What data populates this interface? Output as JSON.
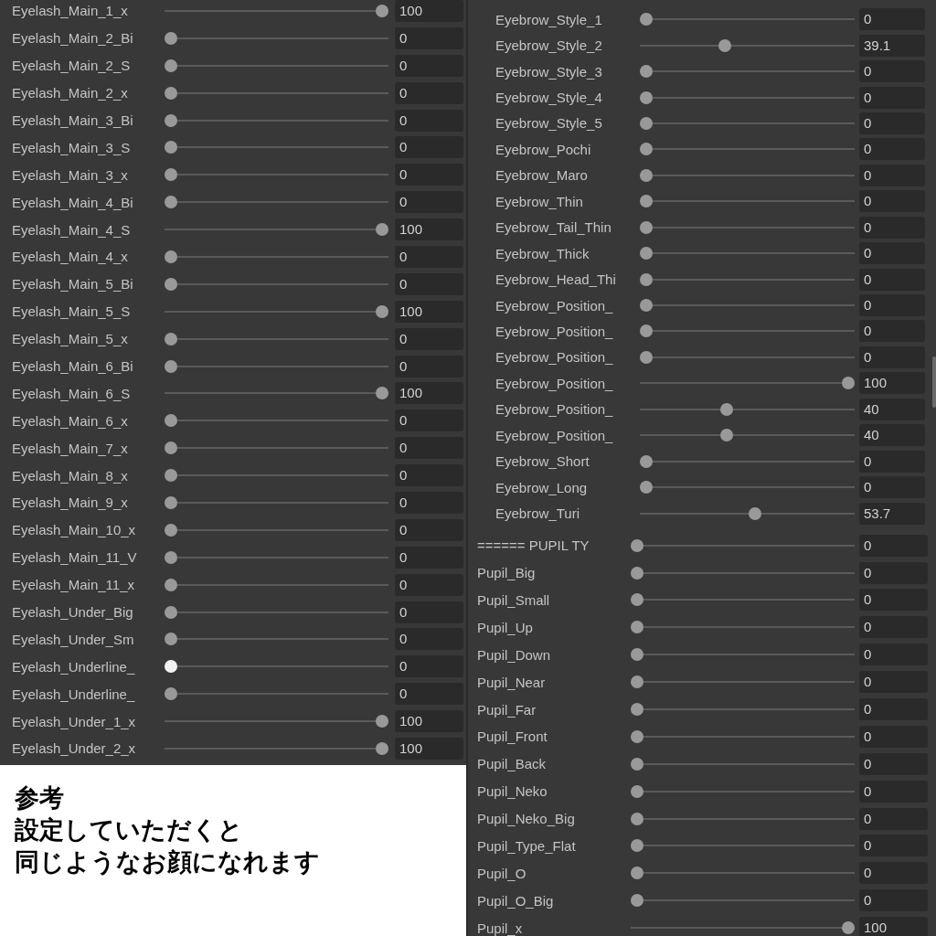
{
  "left_panel": {
    "sliders": [
      {
        "label": "Eyelash_Main_1_x",
        "level": 1,
        "value": "100",
        "active": false
      },
      {
        "label": "Eyelash_Main_2_Bi",
        "level": 0,
        "value": "0",
        "active": false
      },
      {
        "label": "Eyelash_Main_2_S",
        "level": 0,
        "value": "0",
        "active": false
      },
      {
        "label": "Eyelash_Main_2_x",
        "level": 0,
        "value": "0",
        "active": false
      },
      {
        "label": "Eyelash_Main_3_Bi",
        "level": 0,
        "value": "0",
        "active": false
      },
      {
        "label": "Eyelash_Main_3_S",
        "level": 0,
        "value": "0",
        "active": false
      },
      {
        "label": "Eyelash_Main_3_x",
        "level": 0,
        "value": "0",
        "active": false
      },
      {
        "label": "Eyelash_Main_4_Bi",
        "level": 0,
        "value": "0",
        "active": false
      },
      {
        "label": "Eyelash_Main_4_S",
        "level": 1,
        "value": "100",
        "active": false
      },
      {
        "label": "Eyelash_Main_4_x",
        "level": 0,
        "value": "0",
        "active": false
      },
      {
        "label": "Eyelash_Main_5_Bi",
        "level": 0,
        "value": "0",
        "active": false
      },
      {
        "label": "Eyelash_Main_5_S",
        "level": 1,
        "value": "100",
        "active": false
      },
      {
        "label": "Eyelash_Main_5_x",
        "level": 0,
        "value": "0",
        "active": false
      },
      {
        "label": "Eyelash_Main_6_Bi",
        "level": 0,
        "value": "0",
        "active": false
      },
      {
        "label": "Eyelash_Main_6_S",
        "level": 1,
        "value": "100",
        "active": false
      },
      {
        "label": "Eyelash_Main_6_x",
        "level": 0,
        "value": "0",
        "active": false
      },
      {
        "label": "Eyelash_Main_7_x",
        "level": 0,
        "value": "0",
        "active": false
      },
      {
        "label": "Eyelash_Main_8_x",
        "level": 0,
        "value": "0",
        "active": false
      },
      {
        "label": "Eyelash_Main_9_x",
        "level": 0,
        "value": "0",
        "active": false
      },
      {
        "label": "Eyelash_Main_10_x",
        "level": 0,
        "value": "0",
        "active": false
      },
      {
        "label": "Eyelash_Main_11_V",
        "level": 0,
        "value": "0",
        "active": false
      },
      {
        "label": "Eyelash_Main_11_x",
        "level": 0,
        "value": "0",
        "active": false
      },
      {
        "label": "Eyelash_Under_Big",
        "level": 0,
        "value": "0",
        "active": false
      },
      {
        "label": "Eyelash_Under_Sm",
        "level": 0,
        "value": "0",
        "active": false
      },
      {
        "label": "Eyelash_Underline_",
        "level": 0,
        "value": "0",
        "active": true
      },
      {
        "label": "Eyelash_Underline_",
        "level": 0,
        "value": "0",
        "active": false
      },
      {
        "label": "Eyelash_Under_1_x",
        "level": 1,
        "value": "100",
        "active": false
      },
      {
        "label": "Eyelash_Under_2_x",
        "level": 1,
        "value": "100",
        "active": false
      }
    ]
  },
  "caption": {
    "lines": [
      "参考",
      "設定していただくと",
      "同じようなお顔になれます"
    ]
  },
  "right_panel": {
    "eyebrow_sliders": [
      {
        "label": "Eyebrow_Style_1",
        "level": 0,
        "value": "0"
      },
      {
        "label": "Eyebrow_Style_2",
        "level": 0.391,
        "value": "39.1"
      },
      {
        "label": "Eyebrow_Style_3",
        "level": 0,
        "value": "0"
      },
      {
        "label": "Eyebrow_Style_4",
        "level": 0,
        "value": "0"
      },
      {
        "label": "Eyebrow_Style_5",
        "level": 0,
        "value": "0"
      },
      {
        "label": "Eyebrow_Pochi",
        "level": 0,
        "value": "0"
      },
      {
        "label": "Eyebrow_Maro",
        "level": 0,
        "value": "0"
      },
      {
        "label": "Eyebrow_Thin",
        "level": 0,
        "value": "0"
      },
      {
        "label": "Eyebrow_Tail_Thin",
        "level": 0,
        "value": "0"
      },
      {
        "label": "Eyebrow_Thick",
        "level": 0,
        "value": "0"
      },
      {
        "label": "Eyebrow_Head_Thi",
        "level": 0,
        "value": "0"
      },
      {
        "label": "Eyebrow_Position_",
        "level": 0,
        "value": "0"
      },
      {
        "label": "Eyebrow_Position_",
        "level": 0,
        "value": "0"
      },
      {
        "label": "Eyebrow_Position_",
        "level": 0,
        "value": "0"
      },
      {
        "label": "Eyebrow_Position_",
        "level": 1,
        "value": "100"
      },
      {
        "label": "Eyebrow_Position_",
        "level": 0.4,
        "value": "40"
      },
      {
        "label": "Eyebrow_Position_",
        "level": 0.4,
        "value": "40"
      },
      {
        "label": "Eyebrow_Short",
        "level": 0,
        "value": "0"
      },
      {
        "label": "Eyebrow_Long",
        "level": 0,
        "value": "0"
      },
      {
        "label": "Eyebrow_Turi",
        "level": 0.537,
        "value": "53.7"
      }
    ],
    "pupil_sliders": [
      {
        "label": "====== PUPIL TY",
        "level": 0,
        "value": "0"
      },
      {
        "label": "Pupil_Big",
        "level": 0,
        "value": "0"
      },
      {
        "label": "Pupil_Small",
        "level": 0,
        "value": "0"
      },
      {
        "label": "Pupil_Up",
        "level": 0,
        "value": "0"
      },
      {
        "label": "Pupil_Down",
        "level": 0,
        "value": "0"
      },
      {
        "label": "Pupil_Near",
        "level": 0,
        "value": "0"
      },
      {
        "label": "Pupil_Far",
        "level": 0,
        "value": "0"
      },
      {
        "label": "Pupil_Front",
        "level": 0,
        "value": "0"
      },
      {
        "label": "Pupil_Back",
        "level": 0,
        "value": "0"
      },
      {
        "label": "Pupil_Neko",
        "level": 0,
        "value": "0"
      },
      {
        "label": "Pupil_Neko_Big",
        "level": 0,
        "value": "0"
      },
      {
        "label": "Pupil_Type_Flat",
        "level": 0,
        "value": "0"
      },
      {
        "label": "Pupil_O",
        "level": 0,
        "value": "0"
      },
      {
        "label": "Pupil_O_Big",
        "level": 0,
        "value": "0"
      },
      {
        "label": "Pupil_x",
        "level": 1,
        "value": "100"
      }
    ]
  }
}
